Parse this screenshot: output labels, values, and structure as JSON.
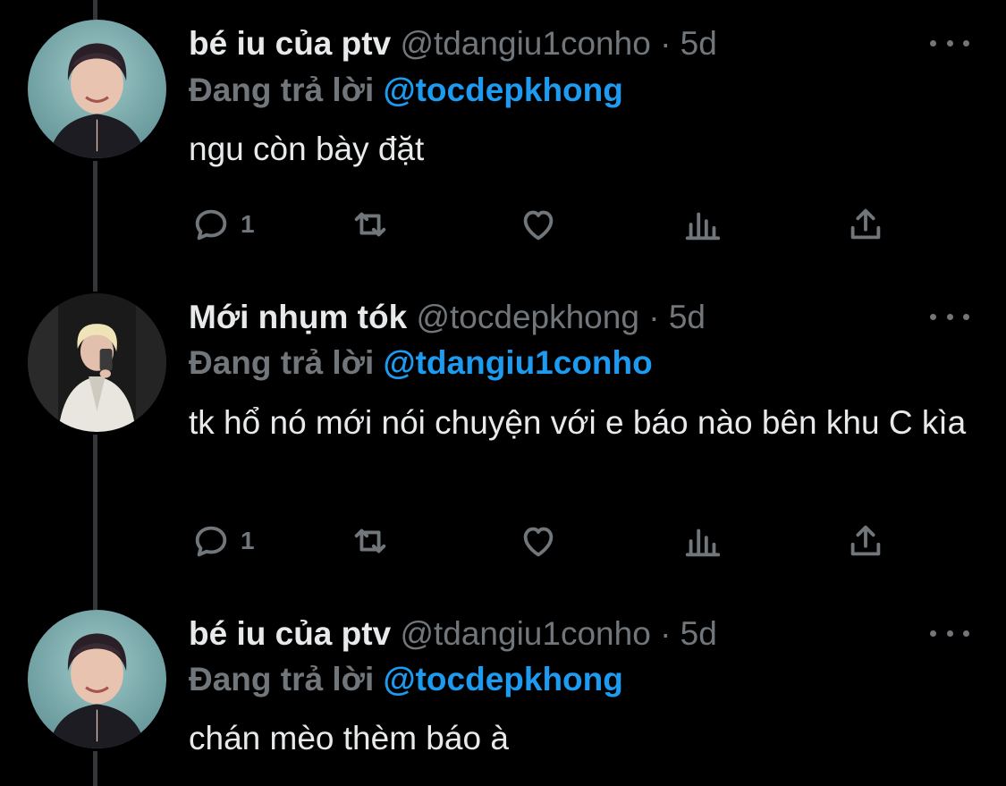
{
  "tweets": [
    {
      "name": "bé iu của ptv",
      "handle": "@tdangiu1conho",
      "separator": "·",
      "time": "5d",
      "replying_label": "Đang trả lời",
      "replying_to": "@tocdepkhong",
      "text": "ngu còn bày đặt",
      "reply_count": "1",
      "avatar_icon": "avatar-photo-dark-hair"
    },
    {
      "name": "Mới nhụm tók",
      "handle": "@tocdepkhong",
      "separator": "·",
      "time": "5d",
      "replying_label": "Đang trả lời",
      "replying_to": "@tdangiu1conho",
      "text": "tk hổ nó mới nói chuyện với e báo nào bên khu C kìa",
      "reply_count": "1",
      "avatar_icon": "avatar-photo-blonde-mirror-selfie"
    },
    {
      "name": "bé iu của ptv",
      "handle": "@tdangiu1conho",
      "separator": "·",
      "time": "5d",
      "replying_label": "Đang trả lời",
      "replying_to": "@tocdepkhong",
      "text": "chán mèo thèm báo à",
      "avatar_icon": "avatar-photo-dark-hair"
    }
  ],
  "colors": {
    "background": "#000000",
    "text": "#e7e9ea",
    "muted": "#71767b",
    "link": "#1d9bf0"
  }
}
